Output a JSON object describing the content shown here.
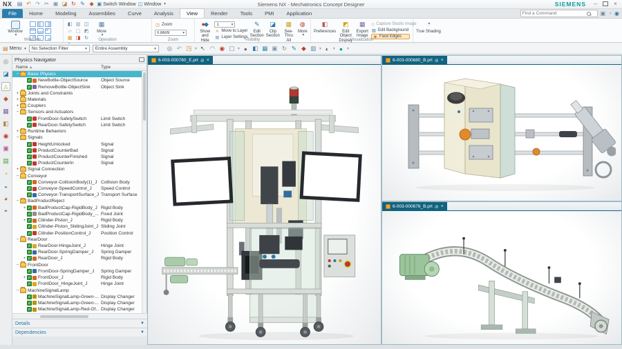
{
  "title_bar": {
    "logo": "NX",
    "title": "Siemens NX - Mechatronics Concept Designer",
    "brand": "SIEMENS",
    "switch_window": "Switch Window",
    "window_menu": "Window"
  },
  "qat_icons": [
    {
      "name": "save-icon",
      "glyph": "▤",
      "color": "#5b7fa6"
    },
    {
      "name": "undo-icon",
      "glyph": "↶",
      "color": "#d07a2a"
    },
    {
      "name": "redo-icon",
      "glyph": "↷",
      "color": "#9aa0a5"
    },
    {
      "name": "cut-icon",
      "glyph": "✂",
      "color": "#7c838a"
    },
    {
      "name": "copy-icon",
      "glyph": "▣",
      "color": "#7c95b3"
    },
    {
      "name": "paste-icon",
      "glyph": "◪",
      "color": "#b0894f"
    },
    {
      "name": "repeat-icon",
      "glyph": "↻",
      "color": "#c0392b"
    },
    {
      "name": "pen-icon",
      "glyph": "✎",
      "color": "#2e77a8"
    },
    {
      "name": "command-icon",
      "glyph": "◆",
      "color": "#b85c2e"
    }
  ],
  "tab_row": {
    "tabs": [
      "File",
      "Home",
      "Modeling",
      "Assemblies",
      "Curve",
      "Analysis",
      "View",
      "Render",
      "Tools",
      "PMI",
      "Application"
    ],
    "active": "View",
    "search_placeholder": "Find a Command"
  },
  "ribbon": {
    "window": {
      "button": "Window",
      "group": "Window",
      "layouts": [
        "f-n",
        "f-l",
        "f-r",
        "f-t",
        "f-b",
        "f-tl",
        "f-tr",
        "f-bl",
        "f-br"
      ]
    },
    "operation": {
      "more": "More",
      "group": "Operation",
      "icons": [
        {
          "name": "cascade-icon",
          "glyph": "◧",
          "color": "#5b7fa6"
        },
        {
          "name": "tile-icon",
          "glyph": "▥",
          "color": "#7c95b3"
        },
        {
          "name": "split-icon",
          "glyph": "◫",
          "color": "#5b7fa6"
        },
        {
          "name": "new-window-icon",
          "glyph": "▱",
          "color": "#9aa0a5"
        },
        {
          "name": "close-window-icon",
          "glyph": "▢",
          "color": "#9aa0a5"
        },
        {
          "name": "layout-icon",
          "glyph": "◩",
          "color": "#7c95b3"
        },
        {
          "name": "image-icon",
          "glyph": "▦",
          "color": "#caa21d"
        },
        {
          "name": "screenshot-icon",
          "glyph": "◨",
          "color": "#c0392b"
        },
        {
          "name": "refresh-icon",
          "glyph": "↻",
          "color": "#2e8bb5"
        },
        {
          "name": "pen-icon",
          "glyph": "✎",
          "color": "#2e77a8"
        }
      ]
    },
    "zoom": {
      "button": "Zoom",
      "value": "0.8609",
      "group": "Zoom"
    },
    "visibility": {
      "show_hide": "Show and Hide",
      "layer_value": "1",
      "move_to_layer": "Move to Layer",
      "layer_settings": "Layer Settings",
      "edit_section": "Edit Section",
      "clip_section": "Clip Section",
      "see_thru": "See-Thru All",
      "more": "More",
      "group": "Visibility"
    },
    "visualization": {
      "preferences": "Preferences",
      "edit_object_display": "Edit Object Display",
      "export_image": "Export Image",
      "capture_studio": "Capture Studio Image",
      "edit_background": "Edit Background",
      "face_edges": "Face Edges",
      "group": "Visualization"
    },
    "true_shading": "True Shading"
  },
  "toolbar": {
    "menu": "Menu",
    "filter": "No Selection Filter",
    "scope": "Entire Assembly",
    "icons": [
      {
        "name": "snap-point-icon",
        "glyph": "◎",
        "color": "#7c838a"
      },
      {
        "name": "undo-icon",
        "glyph": "↶",
        "color": "#9aa0a5"
      },
      {
        "name": "measure-icon",
        "glyph": "◳",
        "color": "#d07a2a",
        "caret": true
      },
      {
        "name": "selection-icon",
        "glyph": "↖",
        "color": "#555b60"
      },
      {
        "name": "lasso-icon",
        "glyph": "◠",
        "color": "#7c838a"
      },
      {
        "name": "highlight-icon",
        "glyph": "◉",
        "color": "#c0392b"
      },
      {
        "name": "region-icon",
        "glyph": "▢",
        "color": "#5b7fa6",
        "caret": true
      },
      {
        "name": "sphere-icon",
        "glyph": "●",
        "color": "#6b7176"
      },
      {
        "name": "cube-icon",
        "glyph": "◧",
        "color": "#2e77a8"
      },
      {
        "name": "monitor-icon",
        "glyph": "▦",
        "color": "#2e8bb5"
      },
      {
        "name": "window-icon",
        "glyph": "▣",
        "color": "#7c95b3"
      },
      {
        "name": "refresh-icon",
        "glyph": "↻",
        "color": "#7c838a"
      },
      {
        "name": "brush-icon",
        "glyph": "✎",
        "color": "#2e77a8"
      },
      {
        "name": "paint-icon",
        "glyph": "◆",
        "color": "#c0392b"
      },
      {
        "name": "grid-icon",
        "glyph": "▥",
        "color": "#5b7fa6",
        "caret": true
      },
      {
        "name": "shade-icon",
        "glyph": "◐",
        "color": "#444a4f",
        "caret": true
      },
      {
        "name": "sphere2-icon",
        "glyph": "●",
        "color": "#0a9a9a",
        "caret": true
      }
    ]
  },
  "resource_bar": {
    "icons": [
      {
        "name": "roles-icon",
        "glyph": "◎",
        "color": "#7c838a"
      },
      {
        "name": "assembly-navigator-icon",
        "glyph": "◪",
        "color": "#2e77a8"
      },
      {
        "name": "physics-navigator-icon",
        "glyph": "◬",
        "color": "#caa21d",
        "active": true
      },
      {
        "name": "constraint-navigator-icon",
        "glyph": "◆",
        "color": "#c0564a"
      },
      {
        "name": "part-navigator-icon",
        "glyph": "▦",
        "color": "#8063a8"
      },
      {
        "name": "reuse-library-icon",
        "glyph": "◧",
        "color": "#b0894f"
      },
      {
        "name": "hd3d-icon",
        "glyph": "◉",
        "color": "#c0392b"
      },
      {
        "name": "view-manager-icon",
        "glyph": "▣",
        "color": "#b85c9e"
      },
      {
        "name": "palette-icon",
        "glyph": "▤",
        "color": "#3da33d"
      },
      {
        "name": "history-icon",
        "glyph": "◔",
        "color": "#caa21d"
      },
      {
        "name": "sequence-editor-icon",
        "glyph": "◒",
        "color": "#2e8bb5"
      },
      {
        "name": "materials-icon",
        "glyph": "◕",
        "color": "#b85c2e"
      },
      {
        "name": "touch-icon",
        "glyph": "◓",
        "color": "#6b7176"
      }
    ]
  },
  "physics_navigator": {
    "title": "Physics Navigator",
    "col_name": "Name",
    "col_type": "Type",
    "details": "Details",
    "dependencies": "Dependencies",
    "rows": [
      {
        "k": "folder",
        "e": "m",
        "n": "Basic Physics",
        "t": "",
        "sel": true
      },
      {
        "k": "item",
        "e": "",
        "n": "NewBottle-ObjectSource",
        "t": "Object Source",
        "g": "#d3691e"
      },
      {
        "k": "item",
        "e": "",
        "n": "RemoveBottle-ObjectSink",
        "t": "Object Sink",
        "g": "#8063a8"
      },
      {
        "k": "folder",
        "e": "p",
        "n": "Joints and Constraints",
        "t": ""
      },
      {
        "k": "folder",
        "e": "p",
        "n": "Materials",
        "t": ""
      },
      {
        "k": "folder",
        "e": "p",
        "n": "Couplers",
        "t": ""
      },
      {
        "k": "folder",
        "e": "m",
        "n": "Sensors and Actuators",
        "t": ""
      },
      {
        "k": "item",
        "e": "",
        "n": "FrontDoor-SafetySwitch",
        "t": "Limit Switch",
        "g": "#c23b2e"
      },
      {
        "k": "item",
        "e": "",
        "n": "RearDoor-SafetySwitch",
        "t": "Limit Switch",
        "g": "#c23b2e"
      },
      {
        "k": "folder",
        "e": "p",
        "n": "Runtime Behaviors",
        "t": ""
      },
      {
        "k": "folder",
        "e": "m",
        "n": "Signals",
        "t": ""
      },
      {
        "k": "item",
        "e": "",
        "n": "HeightUnlocked",
        "t": "Signal",
        "g": "#c0392b"
      },
      {
        "k": "item",
        "e": "",
        "n": "ProductCounterBad",
        "t": "Signal",
        "g": "#c0392b"
      },
      {
        "k": "item",
        "e": "",
        "n": "ProductCounterFinished",
        "t": "Signal",
        "g": "#c0392b"
      },
      {
        "k": "item",
        "e": "",
        "n": "ProductCounterIn",
        "t": "Signal",
        "g": "#c0392b"
      },
      {
        "k": "folder",
        "e": "p",
        "n": "Signal Connection",
        "t": ""
      },
      {
        "k": "folder",
        "e": "m",
        "n": "Conveyor",
        "t": ""
      },
      {
        "k": "item",
        "e": "",
        "n": "Conveyor-CollisionBody(1)_J",
        "t": "Collision Body",
        "g": "#d3691e"
      },
      {
        "k": "item",
        "e": "",
        "n": "Conveyor-SpeedControl_J",
        "t": "Speed Control",
        "g": "#c0392b"
      },
      {
        "k": "item",
        "e": "",
        "n": "Conveyor-TransportSurface_J",
        "t": "Transport Surface",
        "g": "#2e6da4"
      },
      {
        "k": "folder",
        "e": "m",
        "n": "BadProductReject",
        "t": ""
      },
      {
        "k": "item",
        "e": "p",
        "n": "BadProductCap-RigidBody_J",
        "t": "Rigid Body",
        "g": "#d3691e"
      },
      {
        "k": "item",
        "e": "",
        "n": "BadProductCap-RigidBody_...",
        "t": "Fixed Joint",
        "g": "#8a8f94"
      },
      {
        "k": "item",
        "e": "p",
        "n": "Cilinder-Piston_J",
        "t": "Rigid Body",
        "g": "#d3691e"
      },
      {
        "k": "item",
        "e": "",
        "n": "Cilinder-Piston_SlidingJoint_J",
        "t": "Sliding Joint",
        "g": "#d9a81f"
      },
      {
        "k": "item",
        "e": "",
        "n": "Cilinder-PositionControl_J",
        "t": "Position Control",
        "g": "#c0392b"
      },
      {
        "k": "folder",
        "e": "m",
        "n": "RearDoor",
        "t": ""
      },
      {
        "k": "item",
        "e": "",
        "n": "RearDoor-HingeJoint_J",
        "t": "Hinge Joint",
        "g": "#d9a81f"
      },
      {
        "k": "item",
        "e": "",
        "n": "RearDoor-SpringDamper_J",
        "t": "Spring Damper",
        "g": "#2e6da4"
      },
      {
        "k": "item",
        "e": "p",
        "n": "RearDoor_J",
        "t": "Rigid Body",
        "g": "#d3691e"
      },
      {
        "k": "folder",
        "e": "m",
        "n": "FrontDoor",
        "t": ""
      },
      {
        "k": "item",
        "e": "",
        "n": "FrontDoor-SpringDamper_J",
        "t": "Spring Damper",
        "g": "#2e6da4"
      },
      {
        "k": "item",
        "e": "p",
        "n": "FrontDoor_J",
        "t": "Rigid Body",
        "g": "#d3691e"
      },
      {
        "k": "item",
        "e": "",
        "n": "FrontDoor_HingeJoint_J",
        "t": "Hinge Joint",
        "g": "#d9a81f"
      },
      {
        "k": "folder",
        "e": "m",
        "n": "MachineSignalLamp",
        "t": ""
      },
      {
        "k": "item",
        "e": "",
        "n": "MachineSignalLamp-Green-...",
        "t": "Display Changer",
        "g": "#b7950b"
      },
      {
        "k": "item",
        "e": "",
        "n": "MachineSignalLamp-Green-...",
        "t": "Display Changer",
        "g": "#b7950b"
      },
      {
        "k": "item",
        "e": "",
        "n": "MachineSignalLamp-Red-Of...",
        "t": "Display Changer",
        "g": "#b7950b"
      }
    ]
  },
  "viewports": {
    "main": {
      "tab": "6-003-000780_E.prt"
    },
    "top_right": {
      "tab": "6-003-000680_B.prt"
    },
    "bottom_right": {
      "tab": "6-003-000676_B.prt"
    }
  },
  "colors": {
    "accent_teal": "#45b6cc",
    "brand_teal": "#009999",
    "viewport_tab": "#11637f",
    "file_tab": "#2a7eae"
  }
}
